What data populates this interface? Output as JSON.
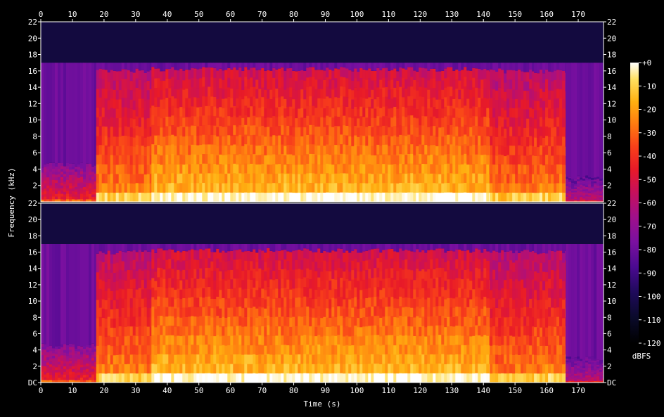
{
  "chart_data": {
    "type": "heatmap",
    "xlabel": "Time (s)",
    "ylabel": "Frequency (kHz)",
    "colorbar_label": "dBFS",
    "x_ticks": [
      0,
      10,
      20,
      30,
      40,
      50,
      60,
      70,
      80,
      90,
      100,
      110,
      120,
      130,
      140,
      150,
      160,
      170
    ],
    "x_range": [
      0,
      178
    ],
    "y_ticks": [
      {
        "value": 0,
        "label": "DC"
      },
      {
        "value": 2,
        "label": "2"
      },
      {
        "value": 4,
        "label": "4"
      },
      {
        "value": 6,
        "label": "6"
      },
      {
        "value": 8,
        "label": "8"
      },
      {
        "value": 10,
        "label": "10"
      },
      {
        "value": 12,
        "label": "12"
      },
      {
        "value": 14,
        "label": "14"
      },
      {
        "value": 16,
        "label": "16"
      },
      {
        "value": 18,
        "label": "18"
      },
      {
        "value": 20,
        "label": "20"
      },
      {
        "value": 22,
        "label": "22"
      }
    ],
    "y_range": [
      0,
      22
    ],
    "colorbar_ticks": [
      "+0",
      "-10",
      "-20",
      "-30",
      "-40",
      "-50",
      "-60",
      "-70",
      "-80",
      "-90",
      "-100",
      "-110",
      "-120"
    ],
    "colorbar_range": [
      -120,
      0
    ],
    "colormap": [
      "#000000",
      "#0a0a2a",
      "#1e0a5a",
      "#4a0a90",
      "#7a10a0",
      "#a0108a",
      "#c8105a",
      "#e81a28",
      "#f8401a",
      "#ff7a10",
      "#ffb010",
      "#ffe060",
      "#ffffff"
    ],
    "channels": [
      {
        "name": "",
        "segments": [
          {
            "start": 0,
            "end": 17.5,
            "bandwidth_khz": 4.5,
            "level": 0.55
          },
          {
            "start": 17.5,
            "end": 35,
            "bandwidth_khz": 16,
            "level": 0.72
          },
          {
            "start": 35,
            "end": 142,
            "bandwidth_khz": 16.2,
            "level": 0.8
          },
          {
            "start": 142,
            "end": 156,
            "bandwidth_khz": 16,
            "level": 0.7
          },
          {
            "start": 156,
            "end": 166,
            "bandwidth_khz": 16,
            "level": 0.72
          },
          {
            "start": 166,
            "end": 178,
            "bandwidth_khz": 3,
            "level": 0.45
          }
        ]
      },
      {
        "name": "",
        "segments": [
          {
            "start": 0,
            "end": 17.5,
            "bandwidth_khz": 4.5,
            "level": 0.55
          },
          {
            "start": 17.5,
            "end": 35,
            "bandwidth_khz": 16,
            "level": 0.72
          },
          {
            "start": 35,
            "end": 142,
            "bandwidth_khz": 16.2,
            "level": 0.8
          },
          {
            "start": 142,
            "end": 156,
            "bandwidth_khz": 16,
            "level": 0.7
          },
          {
            "start": 156,
            "end": 166,
            "bandwidth_khz": 16,
            "level": 0.72
          },
          {
            "start": 166,
            "end": 178,
            "bandwidth_khz": 3,
            "level": 0.45
          }
        ]
      }
    ]
  }
}
